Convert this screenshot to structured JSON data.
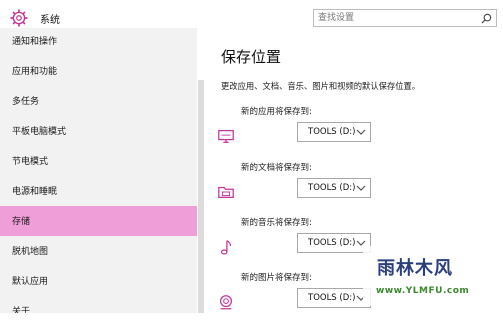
{
  "header": {
    "title": "系统",
    "icon": "gear-icon"
  },
  "search": {
    "placeholder": "查找设置"
  },
  "sidebar": {
    "items": [
      {
        "label": "通知和操作"
      },
      {
        "label": "应用和功能"
      },
      {
        "label": "多任务"
      },
      {
        "label": "平板电脑模式"
      },
      {
        "label": "节电模式"
      },
      {
        "label": "电源和睡眠"
      },
      {
        "label": "存储",
        "active": true
      },
      {
        "label": "脱机地图"
      },
      {
        "label": "默认应用"
      },
      {
        "label": "关于"
      }
    ]
  },
  "main": {
    "title": "保存位置",
    "description": "更改应用、文档、音乐、图片和视频的默认保存位置。",
    "locations": [
      {
        "label": "新的应用将保存到:",
        "value": "TOOLS (D:)",
        "icon": "monitor-icon"
      },
      {
        "label": "新的文档将保存到:",
        "value": "TOOLS (D:)",
        "icon": "folder-icon"
      },
      {
        "label": "新的音乐将保存到:",
        "value": "TOOLS (D:)",
        "icon": "music-note-icon"
      },
      {
        "label": "新的图片将保存到:",
        "value": "TOOLS (D:)",
        "icon": "camera-icon"
      }
    ]
  },
  "watermark": {
    "title": "雨林木风",
    "url": "www.YLMFU.com"
  },
  "colors": {
    "accent": "#ef9ed8",
    "icon": "#c3379b"
  }
}
